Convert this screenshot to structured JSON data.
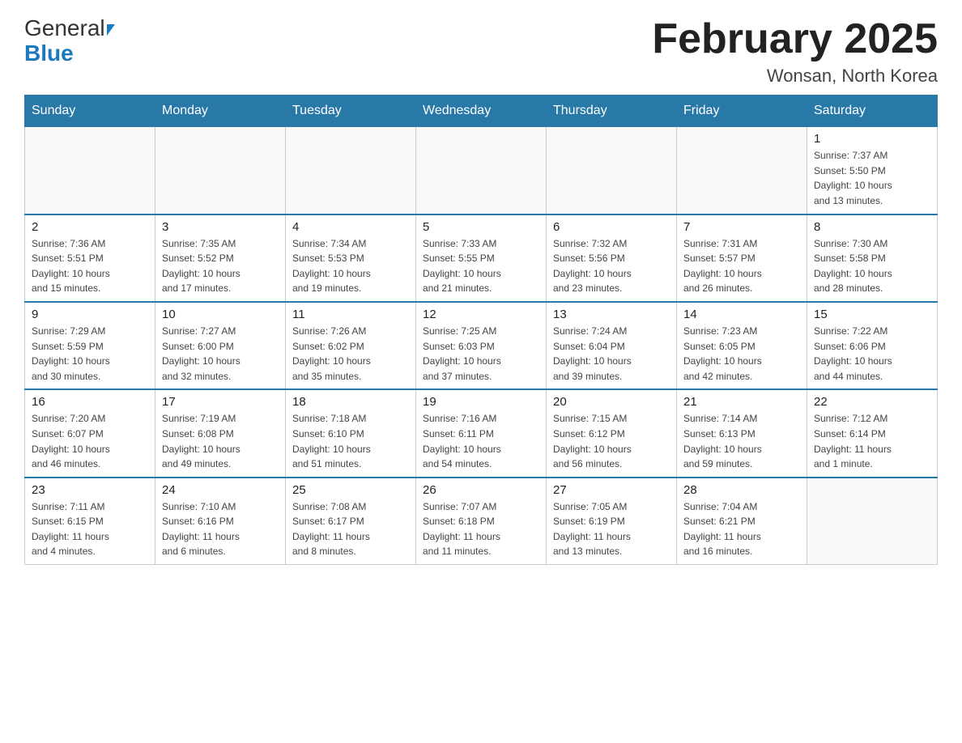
{
  "header": {
    "logo_general": "General",
    "logo_triangle": "▲",
    "logo_blue": "Blue",
    "month_title": "February 2025",
    "location": "Wonsan, North Korea"
  },
  "weekdays": [
    "Sunday",
    "Monday",
    "Tuesday",
    "Wednesday",
    "Thursday",
    "Friday",
    "Saturday"
  ],
  "weeks": [
    [
      {
        "day": "",
        "info": ""
      },
      {
        "day": "",
        "info": ""
      },
      {
        "day": "",
        "info": ""
      },
      {
        "day": "",
        "info": ""
      },
      {
        "day": "",
        "info": ""
      },
      {
        "day": "",
        "info": ""
      },
      {
        "day": "1",
        "info": "Sunrise: 7:37 AM\nSunset: 5:50 PM\nDaylight: 10 hours\nand 13 minutes."
      }
    ],
    [
      {
        "day": "2",
        "info": "Sunrise: 7:36 AM\nSunset: 5:51 PM\nDaylight: 10 hours\nand 15 minutes."
      },
      {
        "day": "3",
        "info": "Sunrise: 7:35 AM\nSunset: 5:52 PM\nDaylight: 10 hours\nand 17 minutes."
      },
      {
        "day": "4",
        "info": "Sunrise: 7:34 AM\nSunset: 5:53 PM\nDaylight: 10 hours\nand 19 minutes."
      },
      {
        "day": "5",
        "info": "Sunrise: 7:33 AM\nSunset: 5:55 PM\nDaylight: 10 hours\nand 21 minutes."
      },
      {
        "day": "6",
        "info": "Sunrise: 7:32 AM\nSunset: 5:56 PM\nDaylight: 10 hours\nand 23 minutes."
      },
      {
        "day": "7",
        "info": "Sunrise: 7:31 AM\nSunset: 5:57 PM\nDaylight: 10 hours\nand 26 minutes."
      },
      {
        "day": "8",
        "info": "Sunrise: 7:30 AM\nSunset: 5:58 PM\nDaylight: 10 hours\nand 28 minutes."
      }
    ],
    [
      {
        "day": "9",
        "info": "Sunrise: 7:29 AM\nSunset: 5:59 PM\nDaylight: 10 hours\nand 30 minutes."
      },
      {
        "day": "10",
        "info": "Sunrise: 7:27 AM\nSunset: 6:00 PM\nDaylight: 10 hours\nand 32 minutes."
      },
      {
        "day": "11",
        "info": "Sunrise: 7:26 AM\nSunset: 6:02 PM\nDaylight: 10 hours\nand 35 minutes."
      },
      {
        "day": "12",
        "info": "Sunrise: 7:25 AM\nSunset: 6:03 PM\nDaylight: 10 hours\nand 37 minutes."
      },
      {
        "day": "13",
        "info": "Sunrise: 7:24 AM\nSunset: 6:04 PM\nDaylight: 10 hours\nand 39 minutes."
      },
      {
        "day": "14",
        "info": "Sunrise: 7:23 AM\nSunset: 6:05 PM\nDaylight: 10 hours\nand 42 minutes."
      },
      {
        "day": "15",
        "info": "Sunrise: 7:22 AM\nSunset: 6:06 PM\nDaylight: 10 hours\nand 44 minutes."
      }
    ],
    [
      {
        "day": "16",
        "info": "Sunrise: 7:20 AM\nSunset: 6:07 PM\nDaylight: 10 hours\nand 46 minutes."
      },
      {
        "day": "17",
        "info": "Sunrise: 7:19 AM\nSunset: 6:08 PM\nDaylight: 10 hours\nand 49 minutes."
      },
      {
        "day": "18",
        "info": "Sunrise: 7:18 AM\nSunset: 6:10 PM\nDaylight: 10 hours\nand 51 minutes."
      },
      {
        "day": "19",
        "info": "Sunrise: 7:16 AM\nSunset: 6:11 PM\nDaylight: 10 hours\nand 54 minutes."
      },
      {
        "day": "20",
        "info": "Sunrise: 7:15 AM\nSunset: 6:12 PM\nDaylight: 10 hours\nand 56 minutes."
      },
      {
        "day": "21",
        "info": "Sunrise: 7:14 AM\nSunset: 6:13 PM\nDaylight: 10 hours\nand 59 minutes."
      },
      {
        "day": "22",
        "info": "Sunrise: 7:12 AM\nSunset: 6:14 PM\nDaylight: 11 hours\nand 1 minute."
      }
    ],
    [
      {
        "day": "23",
        "info": "Sunrise: 7:11 AM\nSunset: 6:15 PM\nDaylight: 11 hours\nand 4 minutes."
      },
      {
        "day": "24",
        "info": "Sunrise: 7:10 AM\nSunset: 6:16 PM\nDaylight: 11 hours\nand 6 minutes."
      },
      {
        "day": "25",
        "info": "Sunrise: 7:08 AM\nSunset: 6:17 PM\nDaylight: 11 hours\nand 8 minutes."
      },
      {
        "day": "26",
        "info": "Sunrise: 7:07 AM\nSunset: 6:18 PM\nDaylight: 11 hours\nand 11 minutes."
      },
      {
        "day": "27",
        "info": "Sunrise: 7:05 AM\nSunset: 6:19 PM\nDaylight: 11 hours\nand 13 minutes."
      },
      {
        "day": "28",
        "info": "Sunrise: 7:04 AM\nSunset: 6:21 PM\nDaylight: 11 hours\nand 16 minutes."
      },
      {
        "day": "",
        "info": ""
      }
    ]
  ]
}
